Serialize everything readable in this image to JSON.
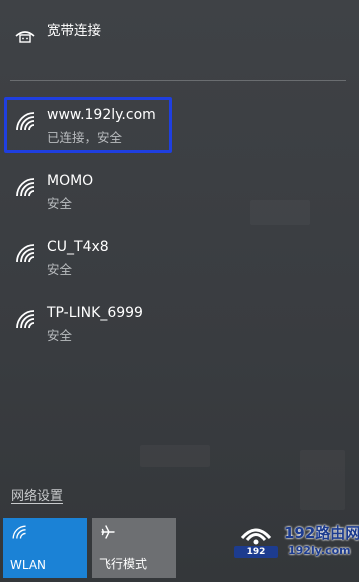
{
  "broadband": {
    "label": "宽带连接",
    "icon": "dialup-icon"
  },
  "networks": [
    {
      "name": "www.192ly.com",
      "status": "已连接，安全",
      "icon": "wifi-icon",
      "connected": true
    },
    {
      "name": "MOMO",
      "status": "安全",
      "icon": "wifi-icon"
    },
    {
      "name": "CU_T4x8",
      "status": "安全",
      "icon": "wifi-icon"
    },
    {
      "name": "TP-LINK_6999",
      "status": "安全",
      "icon": "wifi-icon"
    }
  ],
  "network_settings_label": "网络设置",
  "tiles": {
    "wlan": {
      "label": "WLAN",
      "icon": "wifi-icon",
      "color": "#1b82d6"
    },
    "airplane": {
      "label": "飞行模式",
      "icon": "airplane-icon",
      "color": "#6d6f72"
    }
  },
  "highlight_color": "#1f3fe0",
  "watermark": {
    "title": "192路由网",
    "domain": "192ly.com",
    "badge": "192"
  }
}
